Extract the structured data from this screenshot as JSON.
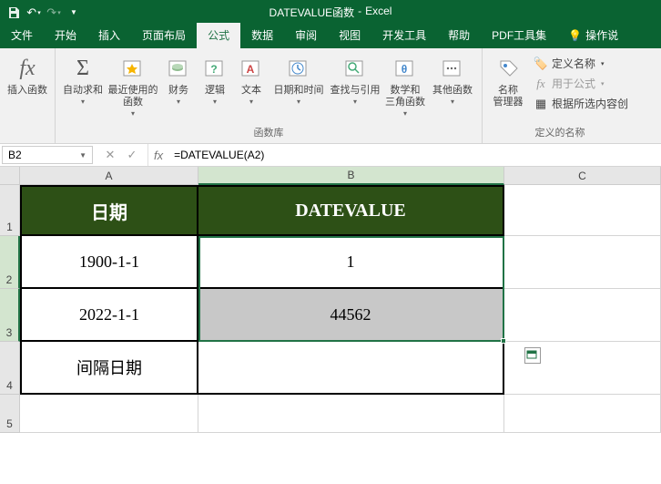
{
  "title": {
    "doc": "DATEVALUE函数",
    "app": "Excel"
  },
  "qat": {
    "save": "💾",
    "undo": "↶",
    "redo": "↷"
  },
  "tabs": {
    "file": "文件",
    "home": "开始",
    "insert": "插入",
    "layout": "页面布局",
    "formulas": "公式",
    "data": "数据",
    "review": "审阅",
    "view": "视图",
    "dev": "开发工具",
    "help": "帮助",
    "pdf": "PDF工具集",
    "tellme": "操作说"
  },
  "ribbon": {
    "insert_fn": "插入函数",
    "autosum": "自动求和",
    "recent": "最近使用的\n函数",
    "financial": "财务",
    "logical": "逻辑",
    "text": "文本",
    "datetime": "日期和时间",
    "lookup": "查找与引用",
    "math": "数学和\n三角函数",
    "more": "其他函数",
    "grp_lib": "函数库",
    "name_mgr": "名称\n管理器",
    "define": "定义名称",
    "use_in": "用于公式",
    "from_sel": "根据所选内容创",
    "grp_names": "定义的名称"
  },
  "namebox": "B2",
  "formula": "=DATEVALUE(A2)",
  "cols": [
    "A",
    "B",
    "C"
  ],
  "rows": [
    "1",
    "2",
    "3",
    "4",
    "5"
  ],
  "cells": {
    "a1": "日期",
    "b1": "DATEVALUE",
    "a2": "1900-1-1",
    "b2": "1",
    "a3": "2022-1-1",
    "b3": "44562",
    "a4": "间隔日期"
  }
}
